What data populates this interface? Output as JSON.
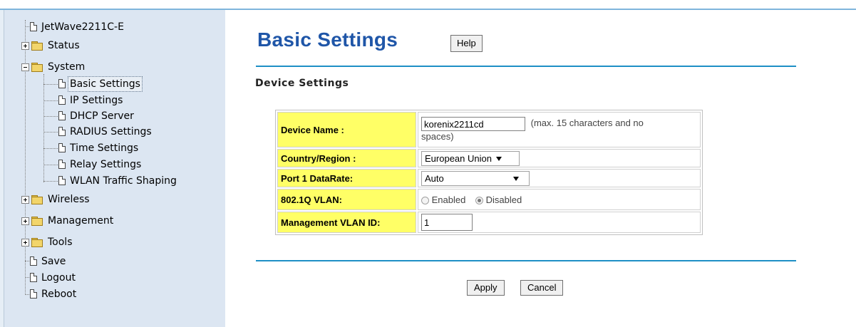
{
  "sidebar": {
    "root": "JetWave2211C-E",
    "status": "Status",
    "system": "System",
    "system_items": [
      "Basic Settings",
      "IP Settings",
      "DHCP Server",
      "RADIUS Settings",
      "Time Settings",
      "Relay Settings",
      "WLAN Traffic Shaping"
    ],
    "wireless": "Wireless",
    "management": "Management",
    "tools": "Tools",
    "save": "Save",
    "logout": "Logout",
    "reboot": "Reboot",
    "selected": "Basic Settings"
  },
  "header": {
    "title": "Basic Settings",
    "help_label": "Help"
  },
  "section_title": "Device Settings",
  "form": {
    "device_name_label": "Device Name :",
    "device_name_value": "korenix2211cd",
    "device_name_hint_1": "(max. 15 characters and no",
    "device_name_hint_2": "spaces)",
    "country_label": "Country/Region :",
    "country_value": "European Union",
    "datarate_label": "Port 1 DataRate:",
    "datarate_value": "Auto",
    "vlan_label": "802.1Q VLAN:",
    "vlan_enabled": "Enabled",
    "vlan_disabled": "Disabled",
    "vlan_selected": "Disabled",
    "mgmt_vlan_label": "Management VLAN ID:",
    "mgmt_vlan_value": "1"
  },
  "actions": {
    "apply": "Apply",
    "cancel": "Cancel"
  },
  "colors": {
    "title": "#1f56a8",
    "label_bg": "#ffff66",
    "sidebar_bg": "#dce6f2",
    "rule": "#1e8fc6"
  }
}
